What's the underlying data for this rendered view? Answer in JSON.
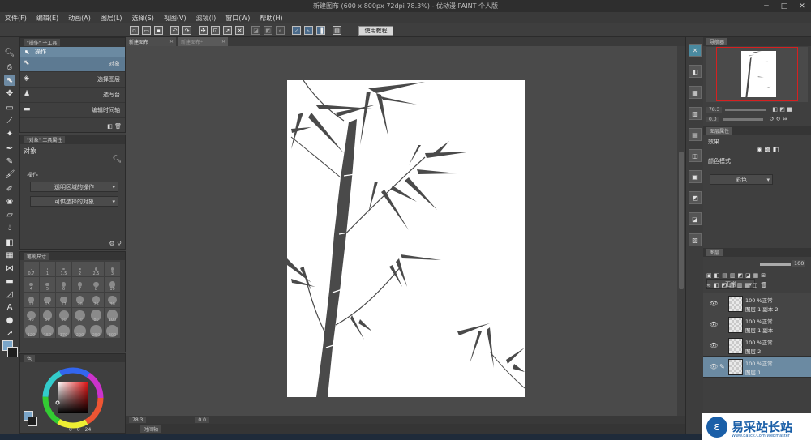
{
  "window": {
    "title": "新建图布 (600 x 800px 72dpi 78.3%) - 优动漫 PAINT 个人版",
    "min": "─",
    "max": "□",
    "close": "✕"
  },
  "menu": [
    "文件(F)",
    "编辑(E)",
    "动画(A)",
    "图层(L)",
    "选择(S)",
    "视图(V)",
    "滤镜(I)",
    "窗口(W)",
    "帮助(H)"
  ],
  "command_bar": {
    "tutorial_button": "使用教程"
  },
  "sub_tool_panel": {
    "tab": "\"操作\" 子工具",
    "group_label": "操作",
    "items": [
      "对象",
      "选择图层",
      "选写台",
      "编辑时间轴"
    ]
  },
  "tool_property_panel": {
    "tab": "\"对象\" 工具属性",
    "title": "对象",
    "section": "操作",
    "dropdown1": "透明区域的操作",
    "dropdown2": "可供选择的对象"
  },
  "brush_size_panel": {
    "tab": "笔刷尺寸",
    "sizes": [
      "0.7",
      "1",
      "1.5",
      "2",
      "2.5",
      "3",
      "4",
      "5",
      "6",
      "7",
      "8",
      "10",
      "12",
      "15",
      "17",
      "20",
      "25",
      "30",
      "40",
      "50",
      "60",
      "70",
      "80",
      "100",
      "120",
      "150",
      "170",
      "200",
      "250",
      "300"
    ]
  },
  "color_panel": {
    "tab": "色",
    "values": [
      "0",
      "0",
      "24"
    ]
  },
  "document_tabs": [
    "新建图布",
    "新建图布*"
  ],
  "status_bar": {
    "zoom": "78.3",
    "angle": "0.0"
  },
  "timeline": {
    "tab": "时间轴"
  },
  "navigator_panel": {
    "tab": "导航器",
    "zoom": "78.3",
    "angle": "0.0"
  },
  "layer_property_panel": {
    "tab": "图层属性",
    "effect_label": "效果",
    "color_mode_label": "颜色模式",
    "color_mode_value": "彩色"
  },
  "layer_panel": {
    "tab": "图层",
    "blend_mode": "正常",
    "opacity": "100",
    "layers": [
      {
        "mode": "100 %正常",
        "name": "图层 1 副本 2",
        "selected": false
      },
      {
        "mode": "100 %正常",
        "name": "图层 1 副本",
        "selected": false
      },
      {
        "mode": "100 %正常",
        "name": "图层 2",
        "selected": false
      },
      {
        "mode": "100 %正常",
        "name": "图层 1",
        "selected": true
      }
    ]
  },
  "watermark": {
    "title": "易采站长站",
    "subtitle": "Www.Easck.Com Webmaster"
  },
  "colors": {
    "accent": "#6b8aa2",
    "canvas_bg": "#4a4a4a",
    "ink": "#4a4a4a",
    "watermark_blue": "#1a5fa8"
  }
}
